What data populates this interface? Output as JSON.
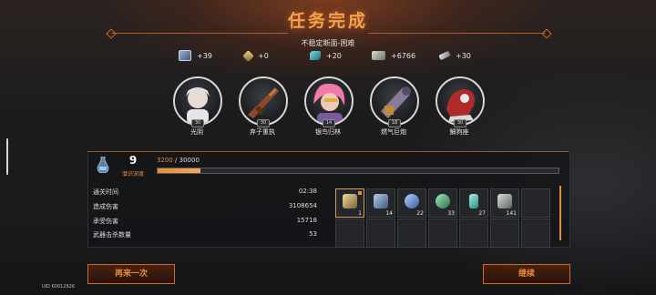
{
  "header": {
    "title": "任务完成",
    "subtitle": "不稳定断面-困难"
  },
  "resources": [
    {
      "icon": "book-icon",
      "value": "+39",
      "color": "#6e8fb5"
    },
    {
      "icon": "gold-token-icon",
      "value": "+0",
      "color": "#c9a45a"
    },
    {
      "icon": "crystal-icon",
      "value": "+20",
      "color": "#2fa0a8"
    },
    {
      "icon": "cash-icon",
      "value": "+6766",
      "color": "#a9b2a2"
    },
    {
      "icon": "key-icon",
      "value": "+30",
      "color": "#c4c7cc"
    }
  ],
  "characters": [
    {
      "name": "光阴",
      "level": "30"
    },
    {
      "name": "弃子重执",
      "level": "30"
    },
    {
      "name": "银鸟归林",
      "level": "14"
    },
    {
      "name": "燃气巨炮",
      "level": "18"
    },
    {
      "name": "鲷狗座",
      "level": "30"
    }
  ],
  "depth": {
    "level": "9",
    "label": "潜识深度",
    "current": "3200",
    "max": "30000",
    "progress": 0.107
  },
  "stats": [
    {
      "label": "通关时间",
      "value": "02:38"
    },
    {
      "label": "造成伤害",
      "value": "3108654"
    },
    {
      "label": "承受伤害",
      "value": "15718"
    },
    {
      "label": "武器击杀数量",
      "value": "53"
    }
  ],
  "rewards": [
    {
      "icon": "badge-icon",
      "count": "1",
      "color": "#c9b06a"
    },
    {
      "icon": "book-icon",
      "count": "14",
      "color": "#7ea0c8"
    },
    {
      "icon": "gem-icon",
      "count": "22",
      "color": "#6fa0e0"
    },
    {
      "icon": "green-gem-icon",
      "count": "33",
      "color": "#5ab07a"
    },
    {
      "icon": "vial-icon",
      "count": "27",
      "color": "#4fc0b0"
    },
    {
      "icon": "module-icon",
      "count": "141",
      "color": "#9aa6a0"
    }
  ],
  "buttons": {
    "retry": "再来一次",
    "continue": "继续"
  },
  "uid": "UID 60012826"
}
